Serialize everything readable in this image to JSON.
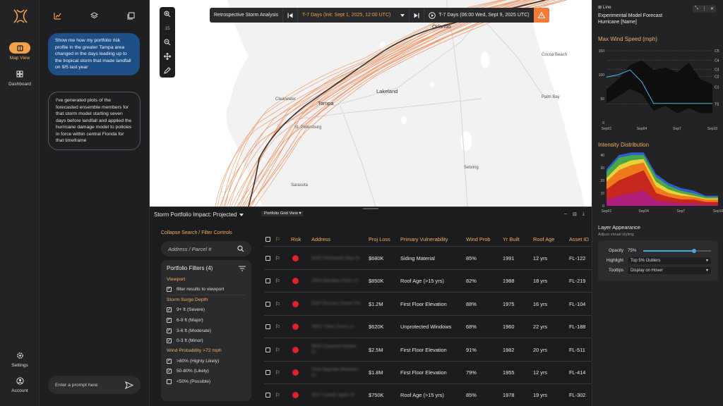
{
  "nav": {
    "items": [
      {
        "label": "Map View",
        "icon": "map-icon",
        "active": true
      },
      {
        "label": "Dashboard",
        "icon": "dashboard-icon",
        "active": false
      },
      {
        "label": "Settings",
        "icon": "gear-icon",
        "active": false
      },
      {
        "label": "Account",
        "icon": "account-icon",
        "active": false
      }
    ]
  },
  "chat": {
    "user_message": "Show me how my portfolio risk profile in the greater Tampa area changed in the days leading up to the tropical storm that made landfall on 9/5 last year",
    "assistant_message": "I've generated plots of the forecasted ensemble members for that storm model starting seven days before landfall and applied the hurricane damage model to policies in force within central Florida for that timeframe",
    "prompt_placeholder": "Enter a prompt here"
  },
  "map": {
    "zoom_level": "15",
    "toolbar": {
      "mode": "Retrospective Storm Analysis",
      "forecast": "T-7 Days (Init: Sept 1, 2025, 12:00 UTC)",
      "playback": "T-7 Days (06:00 Wed, Sept 9, 2025 UTC)"
    },
    "cities": {
      "orlando": "Orlando",
      "tampa": "Tampa",
      "lakeland": "Lakeland",
      "clearwater": "Clearwater",
      "st_petersburg": "St. Petersburg",
      "cocoa_beach": "Cocoa Beach",
      "palm_bay": "Palm Bay",
      "sebring": "Sebring",
      "sarasota": "Sarasota"
    }
  },
  "portfolio": {
    "title": "Storm Portfolio Impact: Projected",
    "view": "Portfolio Grid View",
    "collapse_link": "Collapse Search / Filter Controls",
    "search_placeholder": "Address / Parcel #",
    "filters_title": "Portfolio Filters (4)",
    "filter_groups": [
      {
        "title": "Viewport",
        "options": [
          {
            "label": "filter results to viewport",
            "checked": true
          }
        ]
      },
      {
        "title": "Storm Surge Depth",
        "options": [
          {
            "label": "9+ ft (Severe)",
            "checked": true
          },
          {
            "label": "6-9 ft (Major)",
            "checked": true
          },
          {
            "label": "3-6 ft (Moderate)",
            "checked": true
          },
          {
            "label": "0-3 ft (Minor)",
            "checked": true
          }
        ]
      },
      {
        "title": "Wind Probability >72 mph",
        "options": [
          {
            "label": ">80% (Highly Likely)",
            "checked": true
          },
          {
            "label": "50-80% (Likely)",
            "checked": true
          },
          {
            "label": "<50% (Possible)",
            "checked": false
          }
        ]
      }
    ],
    "columns": [
      "Risk",
      "Address",
      "Proj Loss",
      "Primary Vulnerability",
      "Wind Prob",
      "Yr Built",
      "Roof Age",
      "Asset ID"
    ],
    "rows": [
      {
        "address": "9260 Parkhaven Bay Dr",
        "loss": "$680K",
        "vuln": "Siding Material",
        "wind": "85%",
        "year": "1991",
        "roof": "12 yrs",
        "id": "FL-122"
      },
      {
        "address": "1904 Meridian Point Ct",
        "loss": "$850K",
        "vuln": "Roof Age (>15 yrs)",
        "wind": "82%",
        "year": "1988",
        "roof": "18 yrs",
        "id": "FL-219"
      },
      {
        "address": "5187 Estuary Ocean Rd",
        "loss": "$1.2M",
        "vuln": "First Floor Elevation",
        "wind": "88%",
        "year": "1975",
        "roof": "16 yrs",
        "id": "FL-104"
      },
      {
        "address": "3993 Tribes Echo Ln",
        "loss": "$620K",
        "vuln": "Unprotected Windows",
        "wind": "68%",
        "year": "1960",
        "roof": "22 yrs",
        "id": "FL-188"
      },
      {
        "address": "8820 Crescent Harbor Dr",
        "loss": "$2.5M",
        "vuln": "First Floor Elevation",
        "wind": "91%",
        "year": "1982",
        "roof": "20 yrs",
        "id": "FL-511"
      },
      {
        "address": "7032 Bayside Phantom Ct",
        "loss": "$1.8M",
        "vuln": "First Floor Elevation",
        "wind": "79%",
        "year": "1955",
        "roof": "12 yrs",
        "id": "FL-414"
      },
      {
        "address": "9027 Cobalt Apple St",
        "loss": "$750K",
        "vuln": "Roof Age (>15 yrs)",
        "wind": "85%",
        "year": "1978",
        "roof": "19 yrs",
        "id": "FL-302"
      }
    ]
  },
  "right_panel": {
    "chart_kind": "Line",
    "model_title": "Experimental Model Forecast",
    "model_subtitle": "Hurricane [Name]",
    "wind_title": "Max Wind Speed (mph)",
    "intensity_title": "Intensity Distribution",
    "layer_title": "Layer Appearance",
    "layer_sub": "Adjust visual styling",
    "opacity_label": "Opacity",
    "opacity_value": "75%",
    "opacity_fraction": 0.75,
    "highlight_label": "Highlight",
    "highlight_value": "Top 5% Outliers",
    "tooltips_label": "Tooltips",
    "tooltips_value": "Display on Hover"
  },
  "chart_data": [
    {
      "type": "line",
      "title": "Max Wind Speed (mph)",
      "x": [
        "Sep01",
        "Sep02",
        "Sep03",
        "Sep04",
        "Sep05",
        "Sep06",
        "Sep07",
        "Sep08",
        "Sep09",
        "Sep10"
      ],
      "xticks": [
        "Sep01",
        "Sep04",
        "Sep7",
        "Sep10"
      ],
      "ylim": [
        0,
        150
      ],
      "yticks": [
        0,
        50,
        100,
        150
      ],
      "category_lines": [
        {
          "name": "C5",
          "value": 157
        },
        {
          "name": "C4",
          "value": 130
        },
        {
          "name": "C3",
          "value": 111
        },
        {
          "name": "C2",
          "value": 96
        },
        {
          "name": "C1",
          "value": 74
        },
        {
          "name": "TS",
          "value": 39
        }
      ],
      "series": [
        {
          "name": "upper",
          "values": [
            70,
            90,
            120,
            130,
            110,
            115,
            105,
            125,
            90,
            80
          ]
        },
        {
          "name": "lower",
          "values": [
            40,
            55,
            70,
            60,
            25,
            35,
            20,
            30,
            20,
            20
          ]
        },
        {
          "name": "median",
          "values": [
            95,
            100,
            110,
            85,
            40,
            40,
            40,
            40,
            40,
            40
          ]
        }
      ]
    },
    {
      "type": "area",
      "title": "Intensity Distribution",
      "x": [
        "Sep01",
        "Sep02",
        "Sep03",
        "Sep04",
        "Sep05",
        "Sep06",
        "Sep07",
        "Sep08",
        "Sep09",
        "Sep10"
      ],
      "xticks": [
        "Sep01",
        "Sep04",
        "Sep7",
        "Sep10"
      ],
      "ylim": [
        0,
        40
      ],
      "yticks": [
        0,
        10,
        20,
        30,
        40
      ],
      "colors": [
        "#b0207a",
        "#c7281e",
        "#f07a1a",
        "#e8d23a",
        "#49a84a",
        "#2f5fd0"
      ],
      "series": [
        {
          "name": "s1",
          "values": [
            5,
            8,
            10,
            12,
            4,
            3,
            2,
            2,
            1,
            1
          ]
        },
        {
          "name": "s2",
          "values": [
            8,
            12,
            14,
            16,
            6,
            4,
            3,
            3,
            2,
            2
          ]
        },
        {
          "name": "s3",
          "values": [
            6,
            8,
            8,
            6,
            5,
            3,
            3,
            2,
            2,
            2
          ]
        },
        {
          "name": "s4",
          "values": [
            3,
            4,
            4,
            3,
            4,
            3,
            2,
            1,
            1,
            1
          ]
        },
        {
          "name": "s5",
          "values": [
            5,
            6,
            4,
            3,
            4,
            3,
            2,
            2,
            1,
            1
          ]
        },
        {
          "name": "s6",
          "values": [
            2,
            2,
            2,
            2,
            2,
            2,
            2,
            2,
            1,
            1
          ]
        }
      ]
    }
  ]
}
